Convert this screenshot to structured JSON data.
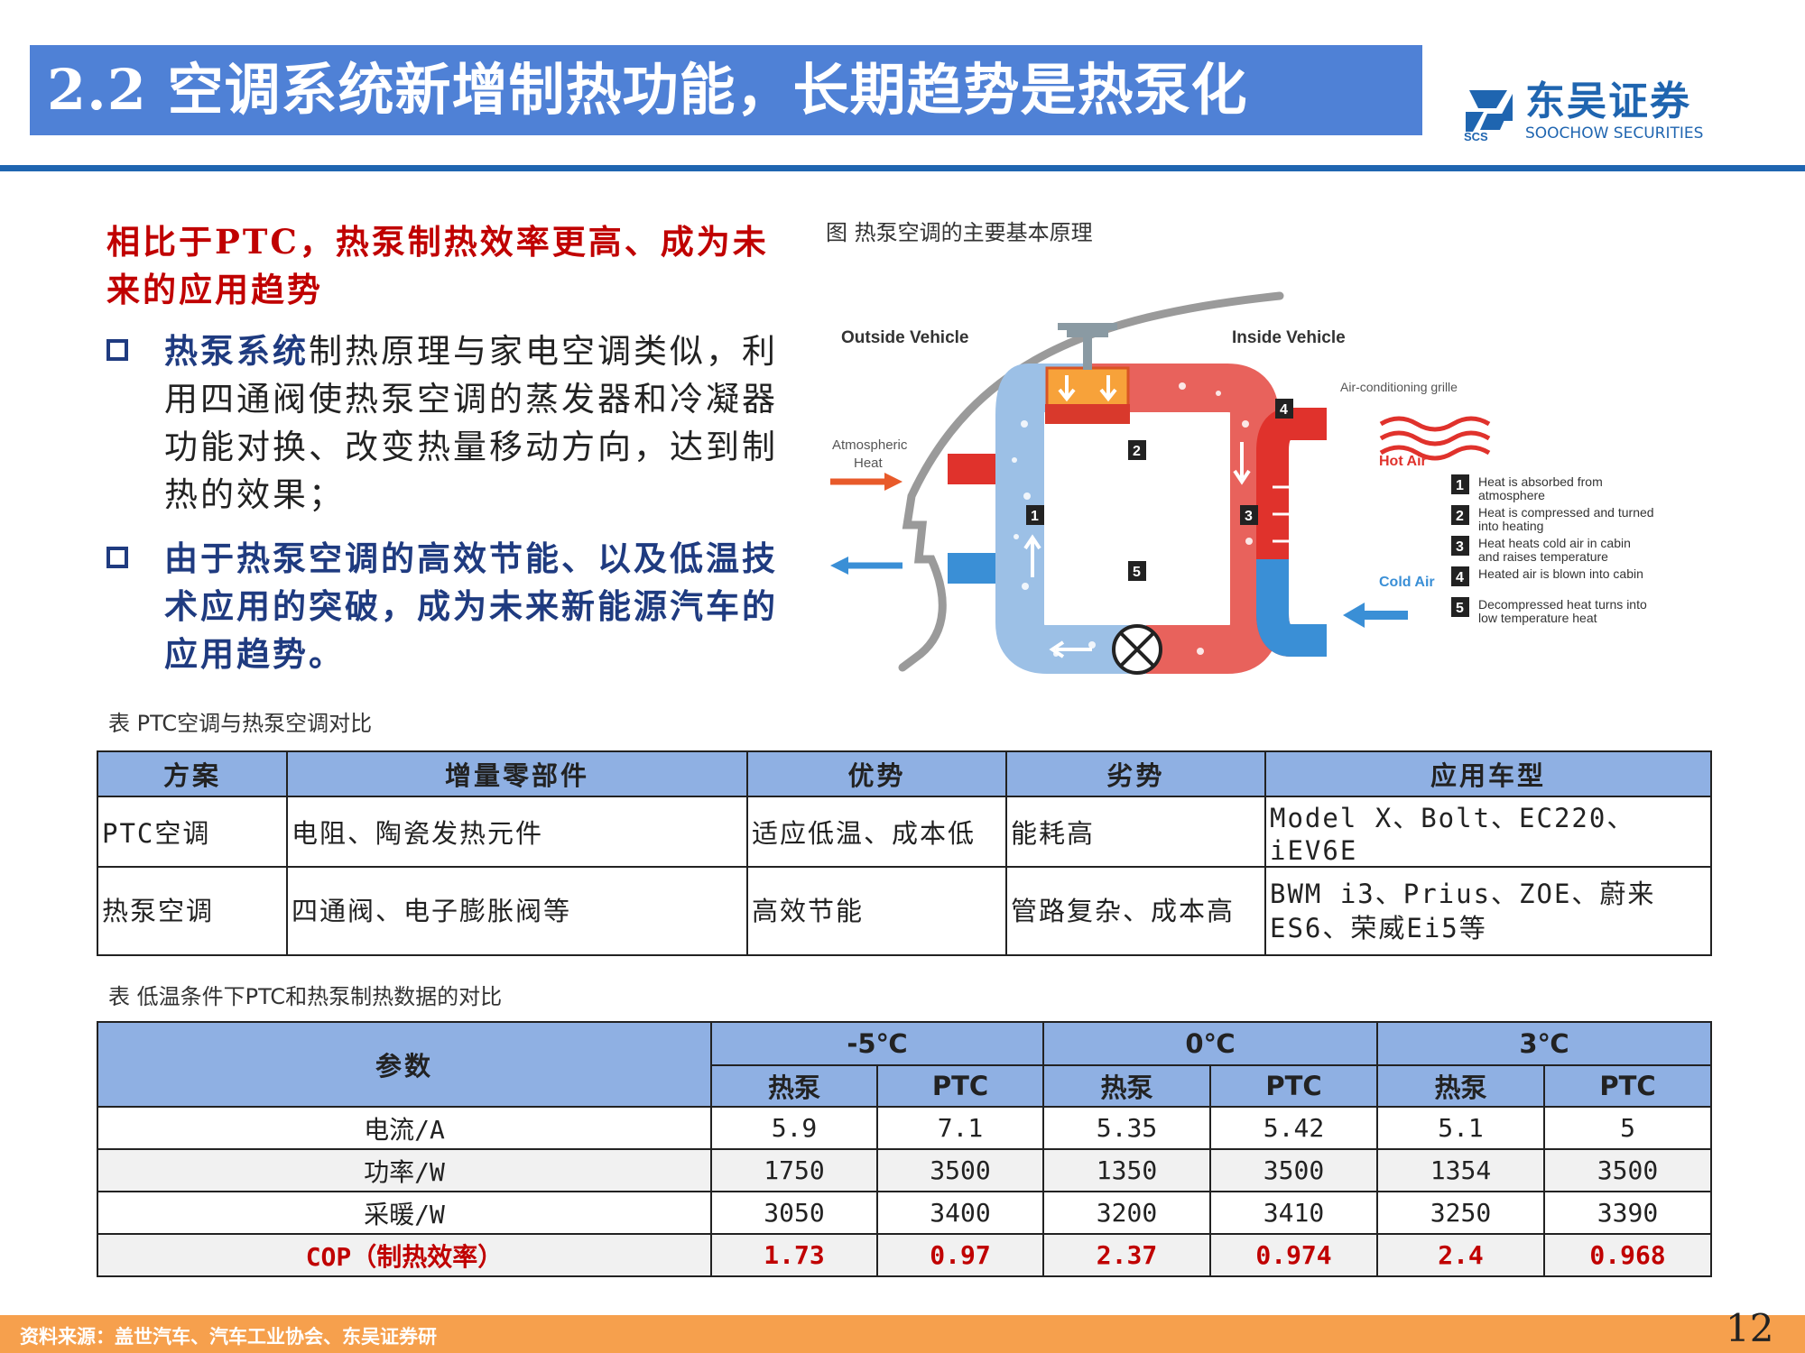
{
  "header": {
    "title": "2.2 空调系统新增制热功能，长期趋势是热泵化",
    "logo_cn": "东吴证券",
    "logo_en": "SOOCHOW SECURITIES",
    "logo_abbr": "SCS"
  },
  "left": {
    "headline": "相比于PTC，热泵制热效率更高、成为未来的应用趋势",
    "bullet1_emphasis": "热泵系统",
    "bullet1_rest": "制热原理与家电空调类似，利用四通阀使热泵空调的蒸发器和冷凝器功能对换、改变热量移动方向，达到制热的效果；",
    "bullet2": "由于热泵空调的高效节能、以及低温技术应用的突破，成为未来新能源汽车的应用趋势。"
  },
  "figure": {
    "caption": "图  热泵空调的主要基本原理",
    "outside_label": "Outside Vehicle",
    "inside_label": "Inside Vehicle",
    "atmospheric_heat_1": "Atmospheric",
    "atmospheric_heat_2": "Heat",
    "ac_grille": "Air-conditioning grille",
    "hot_air": "Hot Air",
    "cold_air": "Cold Air",
    "legend": [
      {
        "num": "1",
        "line1": "Heat is absorbed from",
        "line2": "atmosphere"
      },
      {
        "num": "2",
        "line1": "Heat is compressed and turned",
        "line2": "into heating"
      },
      {
        "num": "3",
        "line1": "Heat heats cold air in cabin",
        "line2": "and raises temperature"
      },
      {
        "num": "4",
        "line1": "Heated air is blown into cabin",
        "line2": ""
      },
      {
        "num": "5",
        "line1": "Decompressed heat turns into",
        "line2": "low temperature heat"
      }
    ],
    "colors": {
      "hot": "#e0322c",
      "cold": "#3a8fd6",
      "pipe_cold": "#9cc0e6",
      "pipe_hot": "#e8625c"
    }
  },
  "table1": {
    "caption": "表  PTC空调与热泵空调对比",
    "headers": [
      "方案",
      "增量零部件",
      "优势",
      "劣势",
      "应用车型"
    ],
    "rows": [
      [
        "PTC空调",
        "电阻、陶瓷发热元件",
        "适应低温、成本低",
        "能耗高",
        "Model X、Bolt、EC220、iEV6E"
      ],
      [
        "热泵空调",
        "四通阀、电子膨胀阀等",
        "高效节能",
        "管路复杂、成本高",
        "BWM i3、Prius、ZOE、蔚来ES6、荣威Ei5等"
      ]
    ]
  },
  "table2": {
    "caption": "表  低温条件下PTC和热泵制热数据的对比",
    "param_header": "参数",
    "temps": [
      "-5℃",
      "0℃",
      "3℃"
    ],
    "sub_headers": [
      "热泵",
      "PTC",
      "热泵",
      "PTC",
      "热泵",
      "PTC"
    ],
    "rows": [
      {
        "label": "电流/A",
        "values": [
          "5.9",
          "7.1",
          "5.35",
          "5.42",
          "5.1",
          "5"
        ]
      },
      {
        "label": "功率/W",
        "values": [
          "1750",
          "3500",
          "1350",
          "3500",
          "1354",
          "3500"
        ]
      },
      {
        "label": "采暖/W",
        "values": [
          "3050",
          "3400",
          "3200",
          "3410",
          "3250",
          "3390"
        ]
      },
      {
        "label": "COP（制热效率）",
        "values": [
          "1.73",
          "0.97",
          "2.37",
          "0.974",
          "2.4",
          "0.968"
        ]
      }
    ]
  },
  "footer": {
    "source": "资料来源：盖世汽车、汽车工业协会、东吴证券研",
    "page": "12"
  }
}
